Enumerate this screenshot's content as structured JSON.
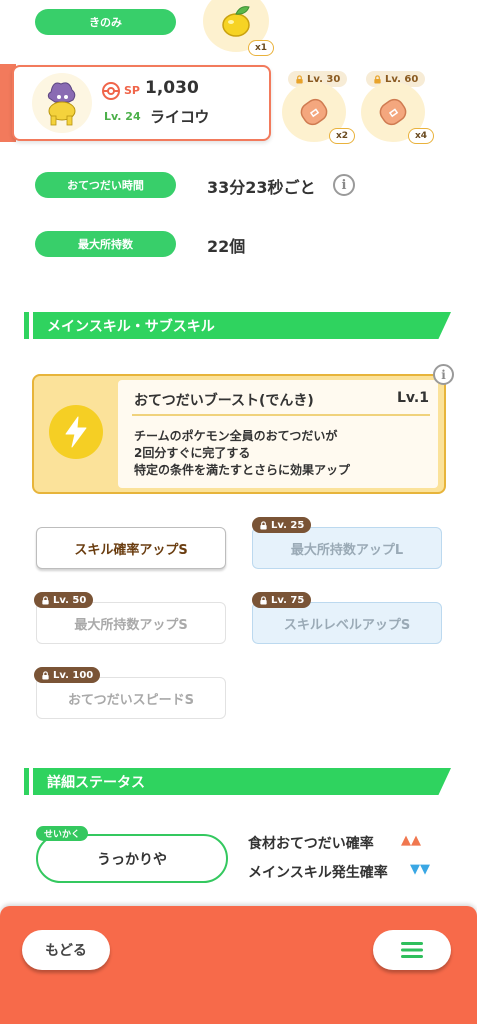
{
  "berry": {
    "label": "きのみ",
    "count": "x1",
    "icon": "lemon-berry-icon"
  },
  "ingredients": [
    {
      "count": "x2",
      "lock_level": "Lv. 30",
      "icon": "sausage-ingredient-icon"
    },
    {
      "count": "x4",
      "lock_level": "Lv. 60",
      "icon": "sausage-ingredient-icon"
    }
  ],
  "pokemon": {
    "sp_label": "SP",
    "sp_value": "1,030",
    "level": "Lv. 24",
    "name": "ライコウ"
  },
  "help_time": {
    "label": "おてつだい時間",
    "value": "33分23秒ごと"
  },
  "max_carry": {
    "label": "最大所持数",
    "value": "22個"
  },
  "skills_section": {
    "title": "メインスキル・サブスキル"
  },
  "main_skill": {
    "name": "おてつだいブースト(でんき)",
    "level": "Lv.1",
    "description": [
      "チームのポケモン全員のおてつだいが",
      "2回分すぐに完了する",
      "特定の条件を満たすとさらに効果アップ"
    ],
    "icon": "lightning-bolt-icon"
  },
  "sub_skills": [
    {
      "label": "スキル確率アップS",
      "lock": ""
    },
    {
      "label": "最大所持数アップL",
      "lock": "Lv. 25"
    },
    {
      "label": "最大所持数アップS",
      "lock": "Lv. 50"
    },
    {
      "label": "スキルレベルアップS",
      "lock": "Lv. 75"
    },
    {
      "label": "おてつだいスピードS",
      "lock": "Lv. 100"
    }
  ],
  "details_section": {
    "title": "詳細ステータス"
  },
  "nature": {
    "tag": "せいかく",
    "value": "うっかりや"
  },
  "modifiers": [
    {
      "label": "食材おてつだい確率",
      "direction": "up",
      "symbol": "▲▲",
      "color": "#f0774f"
    },
    {
      "label": "メインスキル発生確率",
      "direction": "down",
      "symbol": "▼▼",
      "color": "#3aa7e4"
    }
  ],
  "footer": {
    "back_label": "もどる",
    "menu_icon": "hamburger-menu-icon"
  },
  "colors": {
    "accent_green": "#38cf6a",
    "footer_orange": "#f76a4a",
    "skill_gold": "#e7b43a"
  }
}
